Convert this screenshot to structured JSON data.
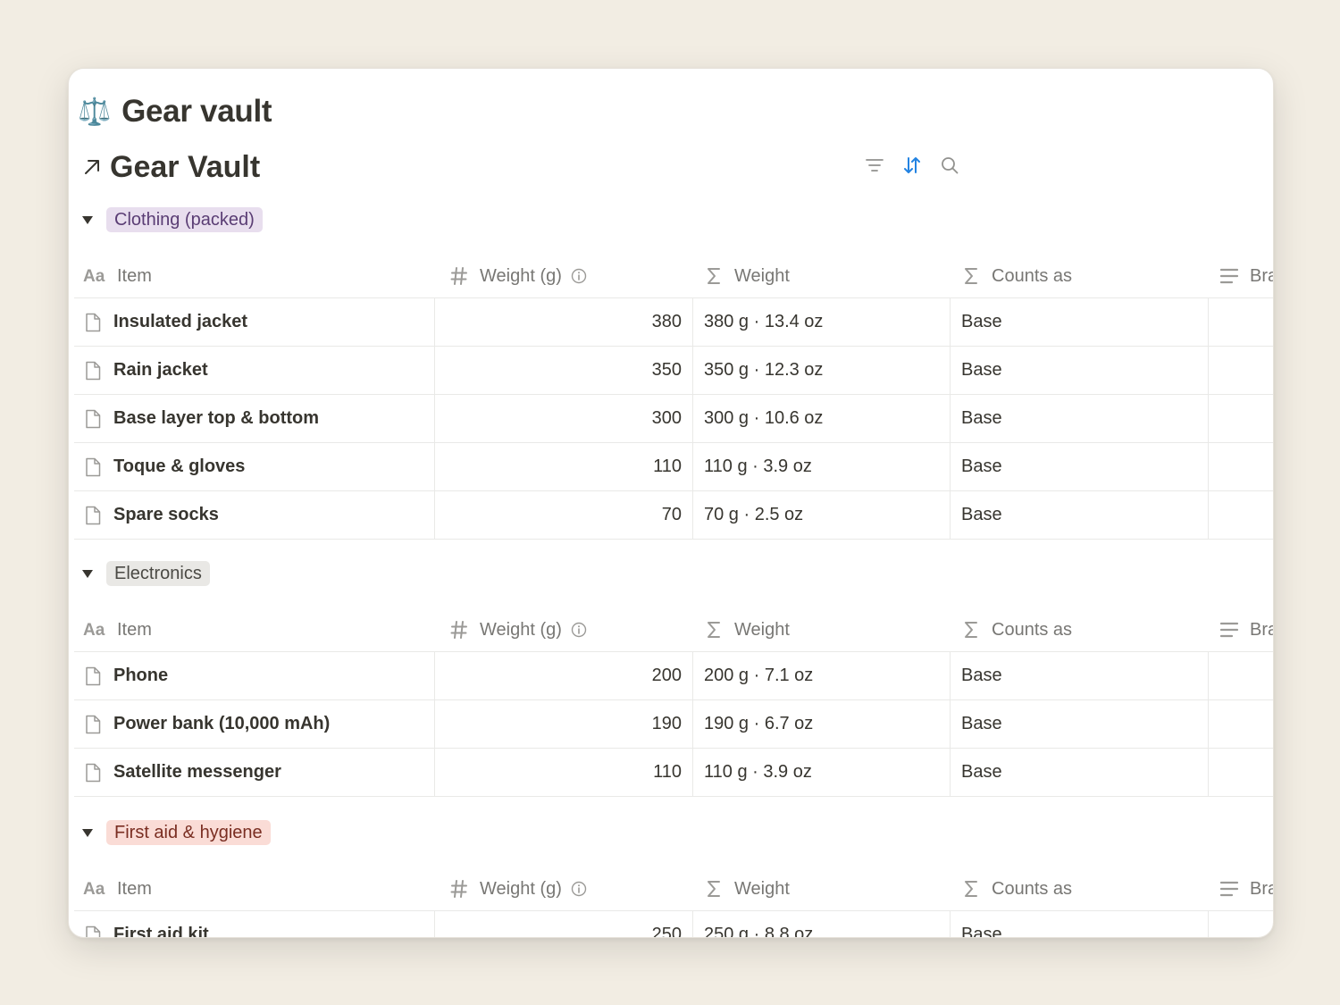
{
  "page": {
    "emoji": "⚖️",
    "title": "Gear vault"
  },
  "database": {
    "title": "Gear Vault"
  },
  "columns": {
    "item": "Item",
    "weight_g": "Weight (g)",
    "weight": "Weight",
    "counts_as": "Counts as",
    "brand": "Bra"
  },
  "groups": [
    {
      "label": "Clothing (packed)",
      "color": "#e8deee",
      "rows": [
        {
          "item": "Insulated jacket",
          "weight_g": "380",
          "weight": "380 g · 13.4 oz",
          "counts_as": "Base"
        },
        {
          "item": "Rain jacket",
          "weight_g": "350",
          "weight": "350 g · 12.3 oz",
          "counts_as": "Base"
        },
        {
          "item": "Base layer top & bottom",
          "weight_g": "300",
          "weight": "300 g · 10.6 oz",
          "counts_as": "Base"
        },
        {
          "item": "Toque & gloves",
          "weight_g": "110",
          "weight": "110 g · 3.9 oz",
          "counts_as": "Base"
        },
        {
          "item": "Spare socks",
          "weight_g": "70",
          "weight": "70 g · 2.5 oz",
          "counts_as": "Base"
        }
      ]
    },
    {
      "label": "Electronics",
      "color": "#e9e8e5",
      "rows": [
        {
          "item": "Phone",
          "weight_g": "200",
          "weight": "200 g · 7.1 oz",
          "counts_as": "Base"
        },
        {
          "item": "Power bank (10,000 mAh)",
          "weight_g": "190",
          "weight": "190 g · 6.7 oz",
          "counts_as": "Base"
        },
        {
          "item": "Satellite messenger",
          "weight_g": "110",
          "weight": "110 g · 3.9 oz",
          "counts_as": "Base"
        }
      ]
    },
    {
      "label": "First aid & hygiene",
      "color": "#fadcd6",
      "rows": [
        {
          "item": "First aid kit",
          "weight_g": "250",
          "weight": "250 g · 8.8 oz",
          "counts_as": "Base"
        }
      ]
    }
  ],
  "colors": {
    "accent": "#2383e2",
    "background": "#f2ede3"
  }
}
